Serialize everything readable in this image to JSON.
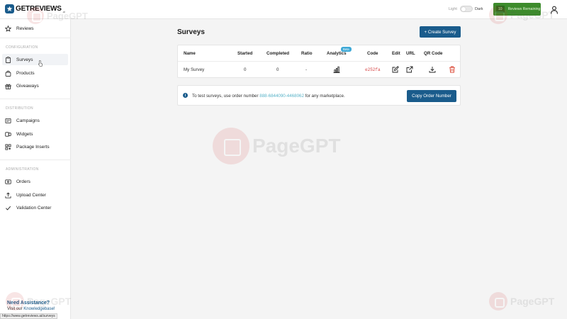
{
  "app": {
    "logo_text": "GETREVIEWS",
    "logo_suffix": ".ai",
    "theme_light": "Light",
    "theme_dark": "Dark",
    "reviews_count": "10",
    "reviews_label": "Reviews Remaining"
  },
  "sidebar": {
    "top_item": "Reviews",
    "sections": {
      "configuration": "CONFIGURATION",
      "distribution": "DISTRIBUTION",
      "administration": "ADMINISTRATION"
    },
    "items": {
      "surveys": "Surveys",
      "products": "Products",
      "giveaways": "Giveaways",
      "campaigns": "Campaigns",
      "widgets": "Widgets",
      "package_inserts": "Package Inserts",
      "orders": "Orders",
      "upload_center": "Upload Center",
      "validation_center": "Validation Center"
    },
    "help_title": "Need Assistance?",
    "help_prefix": "Visit our ",
    "help_link": "Knowledgebase!"
  },
  "status_bar_url": "https://www.getreviews.ai/surveys",
  "main": {
    "title": "Surveys",
    "create_button": "+ Create Survey",
    "table": {
      "headers": {
        "name": "Name",
        "started": "Started",
        "completed": "Completed",
        "ratio": "Ratio",
        "analytics": "Analytics",
        "beta": "Beta",
        "code": "Code",
        "edit": "Edit",
        "url": "URL",
        "qr": "QR Code"
      },
      "row": {
        "name": "My Survey",
        "started": "0",
        "completed": "0",
        "ratio": "-",
        "code": "e252fa"
      }
    },
    "info": {
      "text_before": "To test surveys, use order number ",
      "order_number": "888-6844090-4468062",
      "text_after": " for any marketplace.",
      "copy_button": "Copy Order Number"
    }
  },
  "watermark": "PageGPT",
  "colors": {
    "primary": "#1a5c8c",
    "reviews_bg": "#3d8b2c",
    "code_text": "#d64545",
    "delete_icon": "#d9412e"
  }
}
